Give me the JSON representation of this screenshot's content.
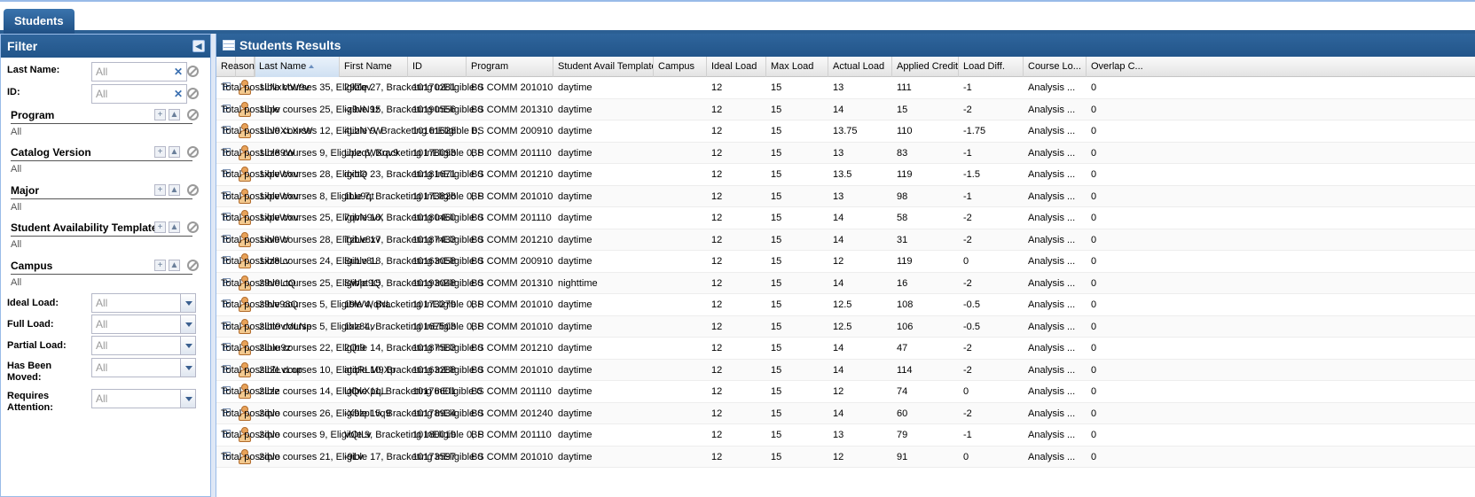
{
  "top_tab": "Students",
  "filter": {
    "title": "Filter",
    "last_name_label": "Last Name:",
    "last_name_placeholder": "All",
    "id_label": "ID:",
    "id_placeholder": "All",
    "sections": [
      {
        "label": "Program",
        "value": "All"
      },
      {
        "label": "Catalog Version",
        "value": "All"
      },
      {
        "label": "Major",
        "value": "All"
      },
      {
        "label": "Student Availability Template",
        "value": "All"
      },
      {
        "label": "Campus",
        "value": "All"
      }
    ],
    "dropdowns": [
      {
        "label": "Ideal Load:",
        "value": "All"
      },
      {
        "label": "Full Load:",
        "value": "All"
      },
      {
        "label": "Partial Load:",
        "value": "All"
      },
      {
        "label": "Has Been Moved:",
        "value": "All"
      },
      {
        "label": "Requires Attention:",
        "value": "All"
      }
    ]
  },
  "results": {
    "title": "Students Results",
    "columns": [
      "Last Name",
      "First Name",
      "ID",
      "Program",
      "Student Avail Template",
      "Campus",
      "Ideal Load",
      "Max Load",
      "Actual Load",
      "Applied Credits",
      "Load Diff.",
      "Course Lo...",
      "Overlap C...",
      "Reason"
    ],
    "rows": [
      [
        "1LNxMW9v",
        "29Zqv",
        "10170281",
        "BS COMM 201010",
        "daytime",
        "",
        "12",
        "15",
        "13",
        "111",
        "-1",
        "Analysis ...",
        "0",
        "Total possible courses 35, Eligible 27, Bracketing InEligible 0"
      ],
      [
        "1Lpv",
        "-z9vN9z",
        "10190556",
        "BS COMM 201310",
        "daytime",
        "",
        "12",
        "15",
        "14",
        "15",
        "-2",
        "Analysis ...",
        "0",
        "Total possible courses 25, Eligible 15, Bracketing InEligible 0"
      ],
      [
        "1Lv9XLXxW",
        "4LzNYW",
        "10161628",
        "BS COMM 200910",
        "daytime",
        "",
        "12",
        "15",
        "13.75",
        "110",
        "-1.75",
        "Analysis ...",
        "0",
        "Total possible courses 12, Eligible 9, Bracketing InEligible 0,"
      ],
      [
        "1Lz89W",
        "UpzqWXqv9",
        "10178093",
        "BS COMM 201110",
        "daytime",
        "",
        "12",
        "15",
        "13",
        "83",
        "-1",
        "Analysis ...",
        "0",
        "Total possible courses 9, Eligible 6, Bracketing InEligible 0, P"
      ],
      [
        "1xpvWxv",
        "dxttQ",
        "10181671",
        "BS COMM 201210",
        "daytime",
        "",
        "12",
        "15",
        "13.5",
        "119",
        "-1.5",
        "Analysis ...",
        "0",
        "Total possible courses 28, Eligible 23, Bracketing InEligible 0"
      ],
      [
        "1xpvWxv",
        "1Lu9qt",
        "10173826",
        "BS COMM 201010",
        "daytime",
        "",
        "12",
        "15",
        "13",
        "98",
        "-1",
        "Analysis ...",
        "0",
        "Total possible courses 8, Eligible 7, Bracketing InEligible 0, P"
      ],
      [
        "1xpvWxv",
        "7qvN9vX",
        "10180460",
        "BS COMM 201110",
        "daytime",
        "",
        "12",
        "15",
        "14",
        "58",
        "-2",
        "Analysis ...",
        "0",
        "Total possible courses 25, Eligible 18, Bracketing InEligible 0"
      ],
      [
        "1xv9W",
        "TzLv8xv",
        "10187433",
        "BS COMM 201210",
        "daytime",
        "",
        "12",
        "15",
        "14",
        "31",
        "-2",
        "Analysis ...",
        "0",
        "Total possible courses 28, Eligible 17, Bracketing InEligible 0"
      ],
      [
        "1xz8Lv",
        "SuLv8L",
        "10163058",
        "BS COMM 200910",
        "daytime",
        "",
        "12",
        "15",
        "12",
        "119",
        "0",
        "Analysis ...",
        "0",
        "Total possible courses 24, Eligible 18, Bracketing InEligible 0"
      ],
      [
        "29v9LtQ",
        "SWpt9Q",
        "10193048",
        "BS COMM 201310",
        "nighttime",
        "",
        "12",
        "15",
        "14",
        "16",
        "-2",
        "Analysis ...",
        "0",
        "Total possible courses 25, Eligible 15, Bracketing InEligible 0"
      ],
      [
        "29vv98Q",
        "19WWqNL",
        "10173279",
        "BS COMM 201010",
        "daytime",
        "",
        "12",
        "15",
        "12.5",
        "108",
        "-0.5",
        "Analysis ...",
        "0",
        "Total possible courses 5, Eligible 4, Bracketing InEligible 0, P"
      ],
      [
        "2Ltt9vMLNp",
        "1xz8Lv",
        "10167503",
        "BS COMM 201010",
        "daytime",
        "",
        "12",
        "15",
        "12.5",
        "106",
        "-0.5",
        "Analysis ...",
        "0",
        "Total possible courses 5, Eligible 4, Bracketing InEligible 0, P"
      ],
      [
        "2Luu9z",
        "2Qt9",
        "10187583",
        "BS COMM 201210",
        "daytime",
        "",
        "12",
        "15",
        "14",
        "47",
        "-2",
        "Analysis ...",
        "0",
        "Total possible courses 22, Eligible 14, Bracketing InEligible 0"
      ],
      [
        "2LZLvLop",
        "atqRLM9Xp",
        "10163288",
        "BS COMM 201010",
        "daytime",
        "",
        "12",
        "15",
        "14",
        "114",
        "-2",
        "Analysis ...",
        "0",
        "Total possible courses 10, Eligible 10, Bracketing InEligible 0"
      ],
      [
        "2Lzz",
        "UQvXpqL",
        "10176601",
        "BS COMM 201110",
        "daytime",
        "",
        "12",
        "15",
        "12",
        "74",
        "0",
        "Analysis ...",
        "0",
        "Total possible courses 14, Eligible 11, Bracketing InEligible 0"
      ],
      [
        "2qvo",
        "-X9zpLvq9",
        "10178934",
        "BS COMM 201240",
        "daytime",
        "",
        "12",
        "15",
        "14",
        "60",
        "-2",
        "Analysis ...",
        "0",
        "Total possible courses 26, Eligible 15, Bracketing InEligible 0"
      ],
      [
        "2qvo",
        "VQtLv",
        "10180019",
        "BS COMM 201110",
        "daytime",
        "",
        "12",
        "15",
        "13",
        "79",
        "-1",
        "Analysis ...",
        "0",
        "Total possible courses 9, Eligible 9, Bracketing InEligible 0, P"
      ],
      [
        "2qvo",
        "-9Lv",
        "10173597",
        "BS COMM 201010",
        "daytime",
        "",
        "12",
        "15",
        "12",
        "91",
        "0",
        "Analysis ...",
        "0",
        "Total possible courses 21, Eligible 17, Bracketing InEligible 0"
      ]
    ]
  }
}
